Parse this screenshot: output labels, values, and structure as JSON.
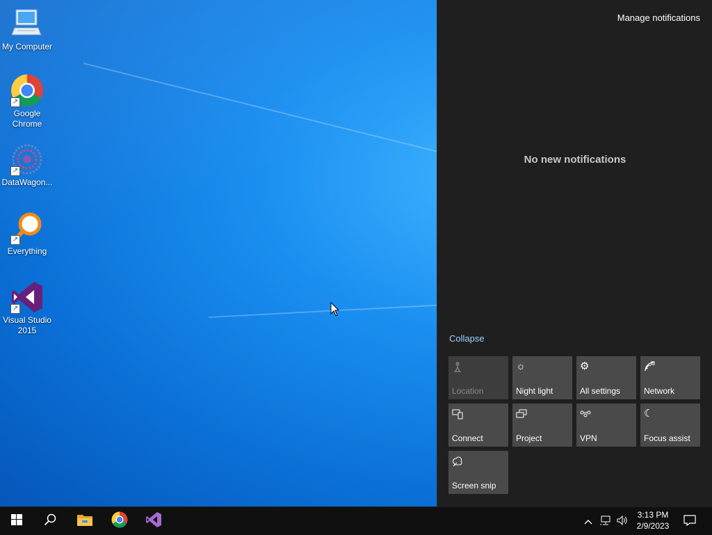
{
  "desktop": {
    "icons": [
      {
        "label": "My Computer",
        "icon": "computer-icon"
      },
      {
        "label": "Google Chrome",
        "icon": "chrome-icon"
      },
      {
        "label": "DataWagon...",
        "icon": "datawagon-icon"
      },
      {
        "label": "Everything",
        "icon": "everything-search-icon"
      },
      {
        "label": "Visual Studio 2015",
        "icon": "visual-studio-icon"
      }
    ]
  },
  "action_center": {
    "manage_label": "Manage notifications",
    "empty_message": "No new notifications",
    "collapse_label": "Collapse",
    "quick_actions": [
      {
        "label": "Location",
        "icon": "location-icon",
        "enabled": false
      },
      {
        "label": "Night light",
        "icon": "night-light-icon",
        "enabled": true
      },
      {
        "label": "All settings",
        "icon": "gear-icon",
        "enabled": true
      },
      {
        "label": "Network",
        "icon": "network-icon",
        "enabled": true
      },
      {
        "label": "Connect",
        "icon": "connect-icon",
        "enabled": true
      },
      {
        "label": "Project",
        "icon": "project-icon",
        "enabled": true
      },
      {
        "label": "VPN",
        "icon": "vpn-icon",
        "enabled": true
      },
      {
        "label": "Focus assist",
        "icon": "moon-icon",
        "enabled": true
      },
      {
        "label": "Screen snip",
        "icon": "screen-snip-icon",
        "enabled": true
      }
    ]
  },
  "taskbar": {
    "pinned": [
      "start-icon",
      "search-icon",
      "file-explorer-icon",
      "chrome-icon",
      "visual-studio-icon"
    ],
    "tray_icons": [
      "chevron-up-icon",
      "network-icon",
      "volume-icon",
      "notification-icon"
    ],
    "time": "3:13 PM",
    "date": "2/9/2023"
  },
  "colors": {
    "desktop_blue": "#0a6fd6",
    "panel_bg": "#1f1f1f",
    "tile_bg": "#4a4a4a",
    "accent_link": "#9fd0ff",
    "taskbar_bg": "#101010"
  }
}
